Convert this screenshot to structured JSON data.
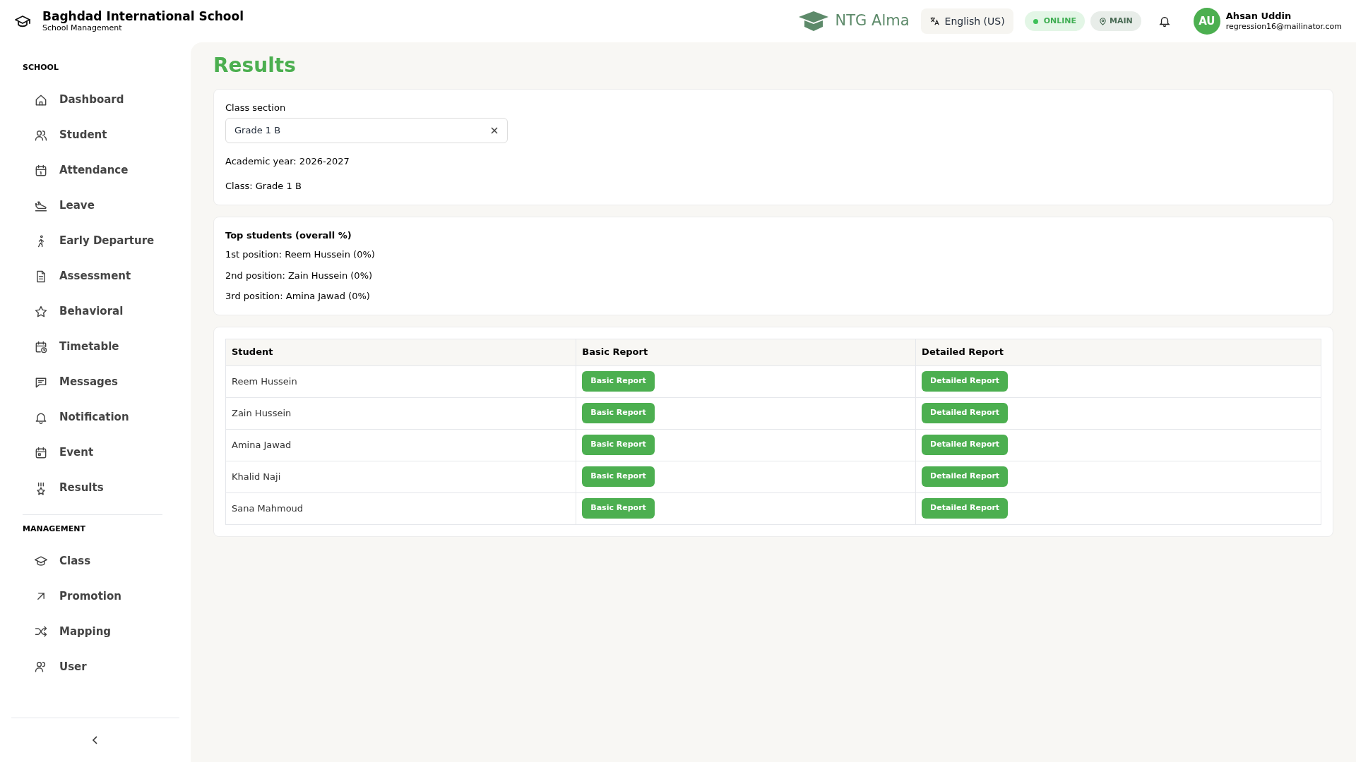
{
  "header": {
    "school_name": "Baghdad International School",
    "subtitle": "School Management",
    "brand": "NTG Alma",
    "language": "English (US)",
    "status": "ONLINE",
    "branch": "MAIN",
    "user": {
      "initials": "AU",
      "name": "Ahsan Uddin",
      "email": "regression16@mailinator.com"
    }
  },
  "sidebar": {
    "sections": [
      {
        "title": "SCHOOL",
        "items": [
          "Dashboard",
          "Student",
          "Attendance",
          "Leave",
          "Early Departure",
          "Assessment",
          "Behavioral",
          "Timetable",
          "Messages",
          "Notification",
          "Event",
          "Results"
        ]
      },
      {
        "title": "MANAGEMENT",
        "items": [
          "Class",
          "Promotion",
          "Mapping",
          "User"
        ]
      }
    ]
  },
  "page": {
    "title": "Results",
    "filter": {
      "label": "Class section",
      "value": "Grade 1 B",
      "academic_year": "Academic year: 2026-2027",
      "class": "Class: Grade 1 B"
    },
    "top_students": {
      "title": "Top students (overall %)",
      "lines": [
        "1st position: Reem Hussein (0%)",
        "2nd position: Zain Hussein (0%)",
        "3rd position: Amina Jawad (0%)"
      ]
    },
    "table": {
      "columns": [
        "Student",
        "Basic Report",
        "Detailed Report"
      ],
      "rows": [
        {
          "student": "Reem Hussein",
          "basic": "Basic Report",
          "detailed": "Detailed Report"
        },
        {
          "student": "Zain Hussein",
          "basic": "Basic Report",
          "detailed": "Detailed Report"
        },
        {
          "student": "Amina Jawad",
          "basic": "Basic Report",
          "detailed": "Detailed Report"
        },
        {
          "student": "Khalid Naji",
          "basic": "Basic Report",
          "detailed": "Detailed Report"
        },
        {
          "student": "Sana Mahmoud",
          "basic": "Basic Report",
          "detailed": "Detailed Report"
        }
      ]
    }
  }
}
